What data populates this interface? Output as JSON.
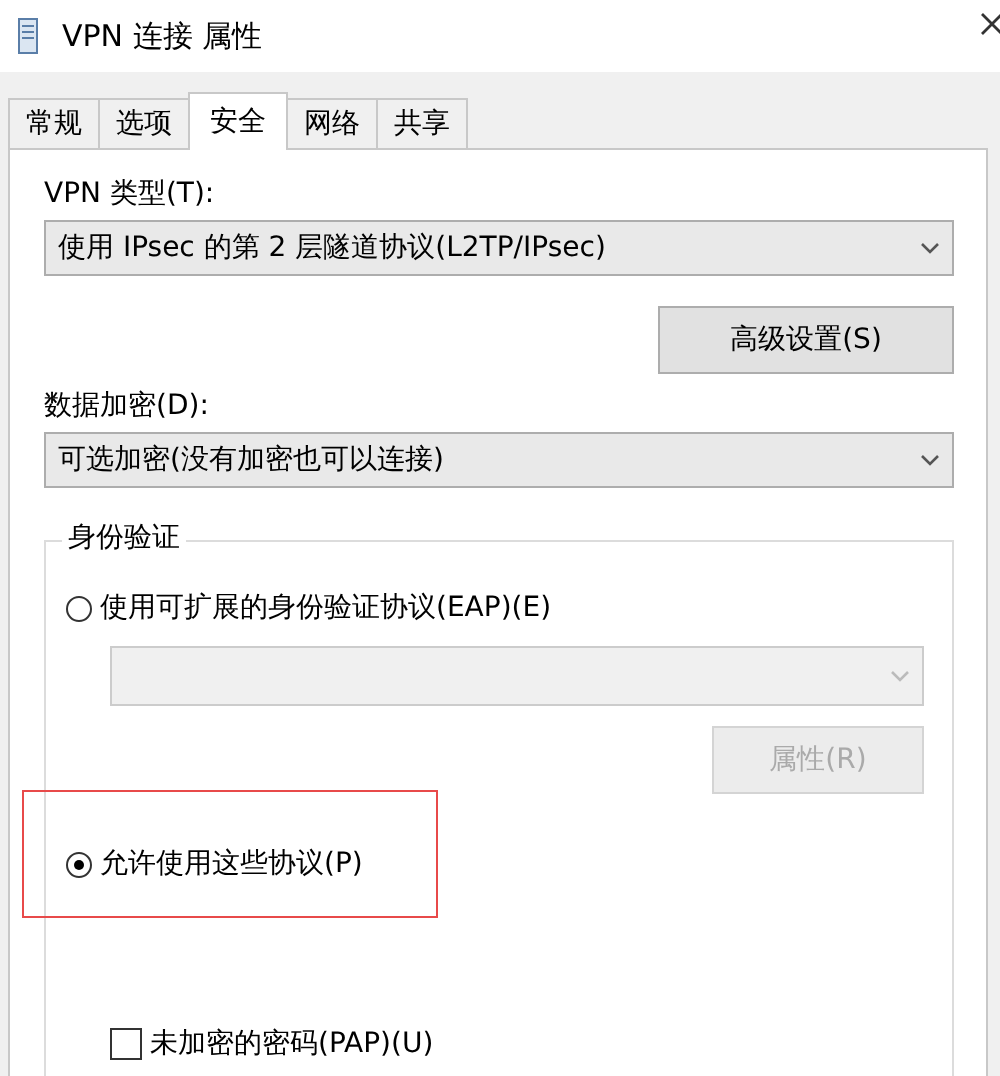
{
  "window": {
    "title": "VPN 连接 属性"
  },
  "tabs": [
    {
      "label": "常规",
      "selected": false
    },
    {
      "label": "选项",
      "selected": false
    },
    {
      "label": "安全",
      "selected": true
    },
    {
      "label": "网络",
      "selected": false
    },
    {
      "label": "共享",
      "selected": false
    }
  ],
  "vpn_type": {
    "label": "VPN 类型(T):",
    "value": "使用 IPsec 的第 2 层隧道协议(L2TP/IPsec)"
  },
  "advanced_button": {
    "label": "高级设置(S)"
  },
  "encryption": {
    "label": "数据加密(D):",
    "value": "可选加密(没有加密也可以连接)"
  },
  "authentication": {
    "legend": "身份验证",
    "options": [
      {
        "kind": "radio",
        "label": "使用可扩展的身份验证协议(EAP)(E)",
        "selected": false,
        "highlighted": false
      },
      {
        "kind": "dropdown",
        "disabled": true
      },
      {
        "kind": "button",
        "label": "属性(R)",
        "disabled": true
      },
      {
        "kind": "radio",
        "label": "允许使用这些协议(P)",
        "selected": true,
        "highlighted": true
      },
      {
        "kind": "checkbox",
        "label": "未加密的密码(PAP)(U)",
        "checked": false
      }
    ]
  }
}
